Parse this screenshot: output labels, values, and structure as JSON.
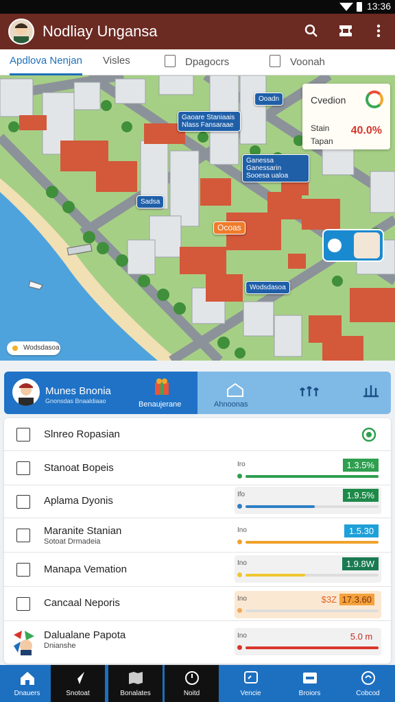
{
  "status": {
    "time": "13:36"
  },
  "appbar": {
    "title": "Nodliay Ungansa",
    "icons": [
      "search-icon",
      "ticket-icon",
      "more-vert-icon"
    ]
  },
  "tabs": [
    {
      "label": "Apdlova Nenjan",
      "active": true
    },
    {
      "label": "Visles"
    },
    {
      "label": "Dpagocrs"
    },
    {
      "label": "Voonah"
    }
  ],
  "map": {
    "pins": [
      "Gaoare Staniaais Nlass Fansaraae",
      "Ganessa Ganessarin Sooesa ualoa",
      "Ooadn",
      "Sadsa",
      "Ocoas",
      "Wodsdasoa"
    ],
    "info": {
      "title": "Cvedion",
      "line1": "Stain",
      "line2": "Tapan",
      "value": "40.0%"
    },
    "scale_label": "Wodsdasoa"
  },
  "summary": {
    "name": "Munes Bnonia",
    "sub": "Gnonsdas Bnaaldiaao",
    "left_button_label": "Benaujerane",
    "right_label": "Ahnoonas"
  },
  "rows": [
    {
      "label": "Slnreo Ropasian",
      "icon": "report-icon"
    },
    {
      "label": "Stanoat Bopeis",
      "icon": "close-box-icon"
    },
    {
      "label": "Aplama Dyonis",
      "icon": "chart-icon"
    },
    {
      "label": "Maranite Stanian",
      "sub": "Sotoat Drmadeia",
      "icon": "grid-icon"
    },
    {
      "label": "Manapa Vemation",
      "icon": "code-icon"
    },
    {
      "label": "Cancaal Neporis",
      "icon": "document-icon"
    },
    {
      "label": "Dalualane Papota",
      "sub": "Dnianshe",
      "icon": "puzzle-avatar-icon"
    }
  ],
  "metrics": [
    {
      "label": "Iro",
      "value": "1.3.5%",
      "fill": 1.0,
      "color": "#2e9e4f",
      "badge_bg": "#2e9e4f"
    },
    {
      "label": "Ifo",
      "value": "1.9.5%",
      "fill": 0.52,
      "color": "#2e7fc4",
      "badge_bg": "#1e8a4a"
    },
    {
      "label": "Ino",
      "value": "1.5.30",
      "fill": 1.0,
      "color": "#f0a22c",
      "badge_bg": "#1ea0d8"
    },
    {
      "label": "Ino",
      "value": "1.9.8W",
      "fill": 0.45,
      "color": "#f0c630",
      "badge_bg": "#1a7a52"
    },
    {
      "label": "Ino",
      "value": "$3Z",
      "value2": "17.3.60",
      "fill": 0.0,
      "color": "#f3a85a",
      "badge_bg": "#f4a23a"
    },
    {
      "label": "Ino",
      "value": "5.0 m",
      "fill": 1.0,
      "color": "#d8352a",
      "badge_bg": "transparent"
    }
  ],
  "nav": [
    {
      "label": "Dnauers",
      "icon": "home-icon"
    },
    {
      "label": "Snotoat",
      "icon": "compass-icon"
    },
    {
      "label": "Bonalates",
      "icon": "map-icon"
    },
    {
      "label": "Noitd",
      "icon": "clock-icon"
    },
    {
      "label": "Vencie",
      "icon": "chat-icon"
    },
    {
      "label": "Broiors",
      "icon": "card-icon"
    },
    {
      "label": "Cobcod",
      "icon": "search-circle-icon"
    }
  ]
}
